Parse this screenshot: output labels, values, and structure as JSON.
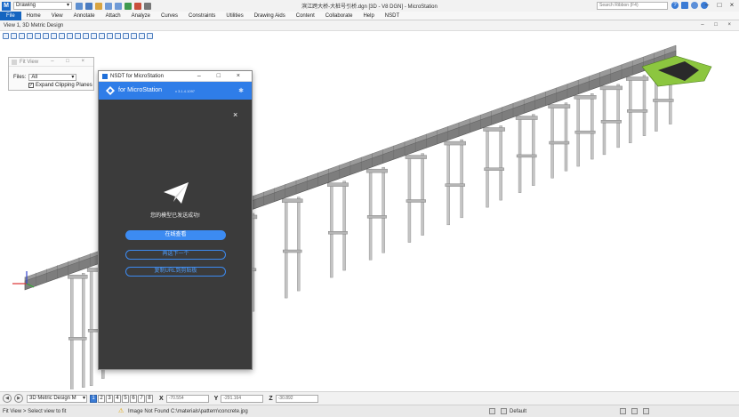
{
  "app": {
    "workspace": "Drawing",
    "title": "滨江跨大桥-大桩号引桥.dgn [3D - V8 DGN] - MicroStation",
    "search_placeholder": "Search Ribbon (F4)"
  },
  "ribbon": {
    "tabs": [
      "File",
      "Home",
      "View",
      "Annotate",
      "Attach",
      "Analyze",
      "Curves",
      "Constraints",
      "Utilities",
      "Drawing Aids",
      "Content",
      "Collaborate",
      "Help",
      "NSDT"
    ]
  },
  "view": {
    "title": "View 1, 3D Metric Design",
    "colors": {
      "deck": "#7d7d7d",
      "pier": "#c4c4c4",
      "abutment": "#8cc63f"
    }
  },
  "fit_view": {
    "title": "Fit View",
    "files_label": "Files:",
    "files_value": "All",
    "expand_label": "Expand Clipping Planes",
    "expand_checked": "✓"
  },
  "nsdt": {
    "window_title": "NSDT for MicroStation",
    "product_name": "for MicroStation",
    "version": "v 3.1.4.1097",
    "message": "您的模型已发送成功!",
    "primary_button": "在线查看",
    "secondary_button": "再选下一个",
    "copy_button": "复制URL到剪贴板"
  },
  "bottom": {
    "view_combo": "3D Metric Design M",
    "view_numbers": [
      "1",
      "2",
      "3",
      "4",
      "5",
      "6",
      "7",
      "8"
    ],
    "active_view": "1",
    "x_label": "X",
    "x_value": "-70.554",
    "y_label": "Y",
    "y_value": "-291.164",
    "z_label": "Z",
    "z_value": "-30.892"
  },
  "status": {
    "prompt": "Fit View > Select view to fit",
    "message": "Image Not Found C:\\materials\\pattern\\concrete.jpg",
    "level": "Default"
  }
}
